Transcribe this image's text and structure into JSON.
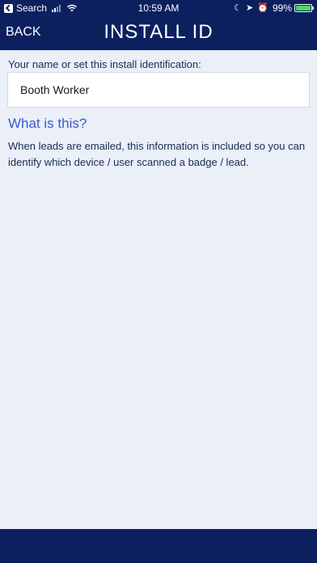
{
  "status_bar": {
    "back_app_label": "Search",
    "time": "10:59 AM",
    "battery_percent": "99%",
    "battery_level": 0.99,
    "icons": [
      "back-arrow-icon",
      "signal-icon",
      "wifi-icon",
      "moon-icon",
      "location-icon",
      "alarm-icon",
      "battery-icon"
    ]
  },
  "header": {
    "back_label": "BACK",
    "title": "INSTALL ID"
  },
  "form": {
    "label": "Your name or set this install identification:",
    "install_id_value": "Booth Worker"
  },
  "help": {
    "heading": "What is this?",
    "body": "When leads are emailed, this information is included so you can identify which device / user scanned a badge / lead."
  },
  "colors": {
    "nav_background": "#0c2060",
    "page_background": "#eaeff8",
    "accent": "#3b59c9",
    "battery": "#4cd964"
  }
}
